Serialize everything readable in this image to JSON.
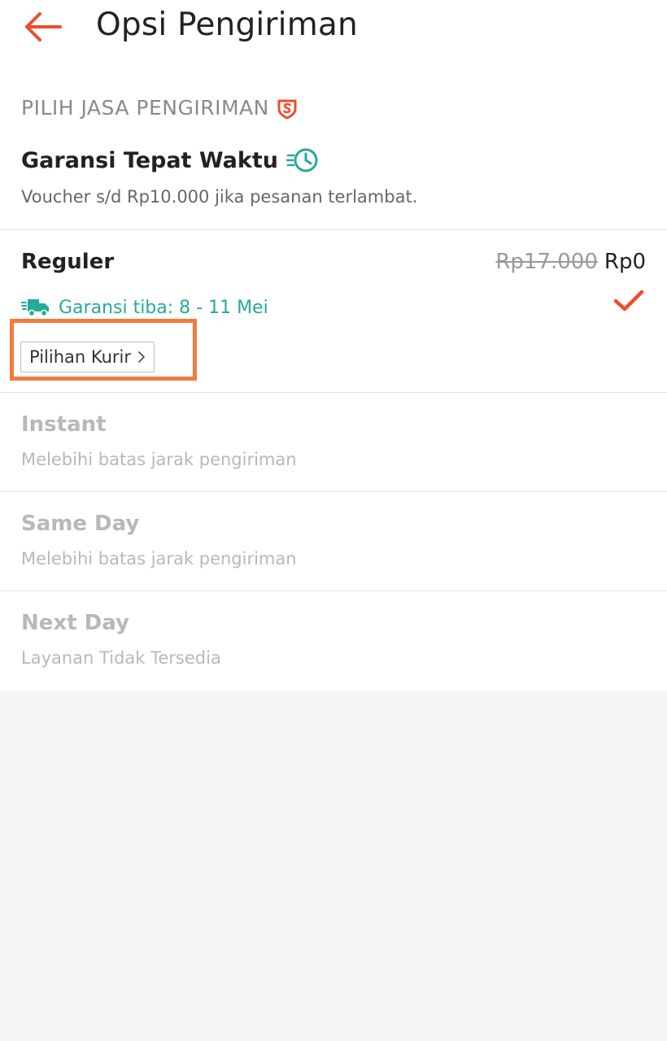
{
  "header": {
    "title": "Opsi Pengiriman",
    "back_icon": "arrow-left-icon"
  },
  "section": {
    "label": "PILIH JASA PENGIRIMAN",
    "label_icon": "shield-s-icon"
  },
  "guarantee": {
    "title": "Garansi Tepat Waktu",
    "title_icon": "fast-clock-icon",
    "description": "Voucher s/d Rp10.000 jika pesanan terlambat."
  },
  "options": {
    "reguler": {
      "name": "Reguler",
      "price_original": "Rp17.000",
      "price_final": "Rp0",
      "eta": "Garansi tiba: 8 - 11 Mei",
      "eta_icon": "delivery-truck-icon",
      "selected_icon": "check-icon",
      "courier_button": "Pilihan Kurir"
    },
    "instant": {
      "name": "Instant",
      "description": "Melebihi batas jarak pengiriman"
    },
    "same_day": {
      "name": "Same Day",
      "description": "Melebihi batas jarak pengiriman"
    },
    "next_day": {
      "name": "Next Day",
      "description": "Layanan Tidak Tersedia"
    }
  },
  "colors": {
    "accent": "#ee4d2d",
    "teal": "#26aa99",
    "highlight": "#f47b3e",
    "disabled_text": "#b8b8b8"
  }
}
